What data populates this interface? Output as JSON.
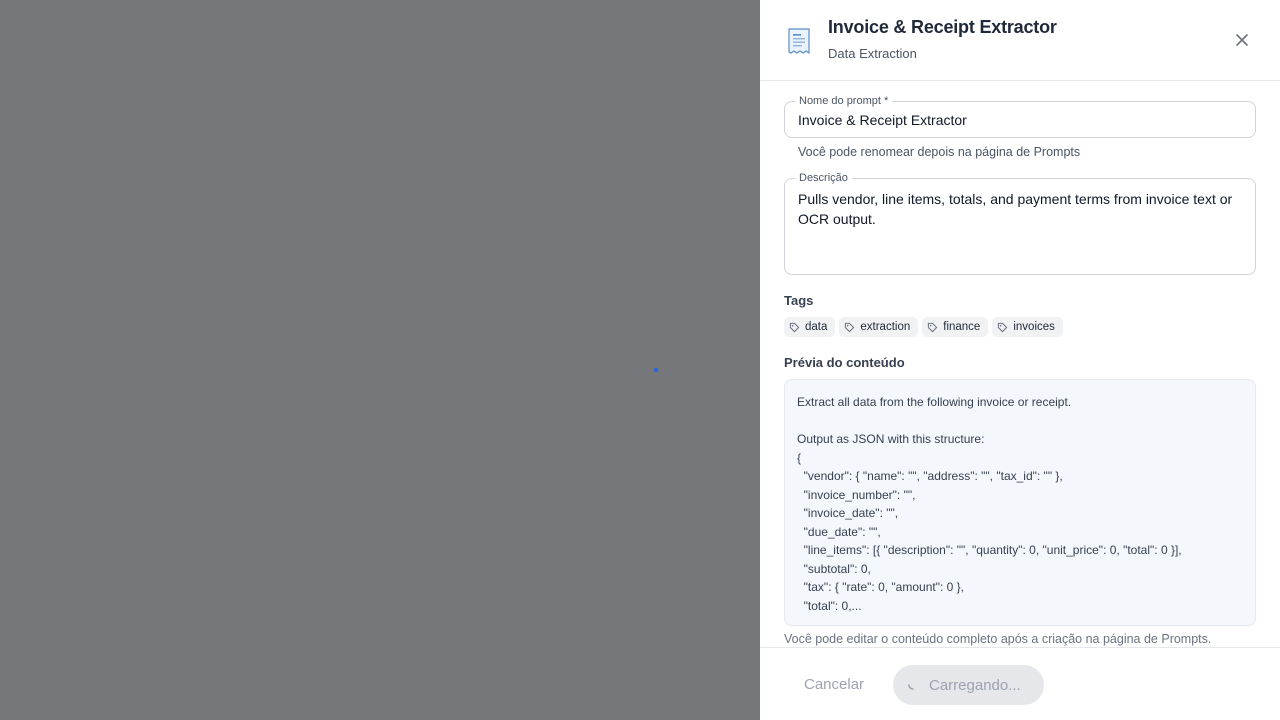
{
  "drawer": {
    "icon": "receipt-icon",
    "title": "Invoice & Receipt Extractor",
    "subtitle": "Data Extraction",
    "close_icon": "close-icon"
  },
  "form": {
    "name_label": "Nome do prompt *",
    "name_value": "Invoice & Receipt Extractor",
    "name_helper": "Você pode renomear depois na página de Prompts",
    "description_label": "Descrição",
    "description_value": "Pulls vendor, line items, totals, and payment terms from invoice text or OCR output.",
    "tags_label": "Tags",
    "tags": [
      "data",
      "extraction",
      "finance",
      "invoices"
    ],
    "tag_icon": "tag-icon",
    "preview_label": "Prévia do conteúdo",
    "preview_text": "Extract all data from the following invoice or receipt.\n\nOutput as JSON with this structure:\n{\n  \"vendor\": { \"name\": \"\", \"address\": \"\", \"tax_id\": \"\" },\n  \"invoice_number\": \"\",\n  \"invoice_date\": \"\",\n  \"due_date\": \"\",\n  \"line_items\": [{ \"description\": \"\", \"quantity\": 0, \"unit_price\": 0, \"total\": 0 }],\n  \"subtotal\": 0,\n  \"tax\": { \"rate\": 0, \"amount\": 0 },\n  \"total\": 0,...",
    "preview_footnote": "Você pode editar o conteúdo completo após a criação na página de Prompts."
  },
  "footer": {
    "cancel_label": "Cancelar",
    "submit_label": "Carregando..."
  },
  "colors": {
    "accent": "#2563eb",
    "overlay": "#76777b"
  }
}
